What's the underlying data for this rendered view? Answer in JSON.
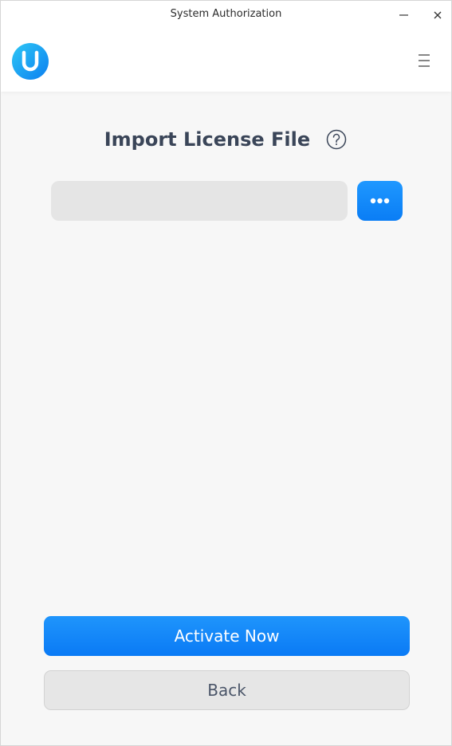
{
  "window": {
    "title": "System Authorization",
    "minimize_icon": "minimize-icon",
    "close_icon": "close-icon"
  },
  "header": {
    "logo_icon": "app-logo-icon",
    "menu_icon": "hamburger-menu-icon"
  },
  "main": {
    "heading": "Import License File",
    "help_icon": "question-circle-icon",
    "file_input": {
      "value": "",
      "placeholder": ""
    },
    "browse_icon": "more-dots-icon"
  },
  "actions": {
    "activate_label": "Activate Now",
    "back_label": "Back"
  },
  "colors": {
    "accent": "#0a84ff",
    "heading": "#3a4558",
    "background": "#f7f7f7",
    "input_bg": "#e5e5e5"
  }
}
